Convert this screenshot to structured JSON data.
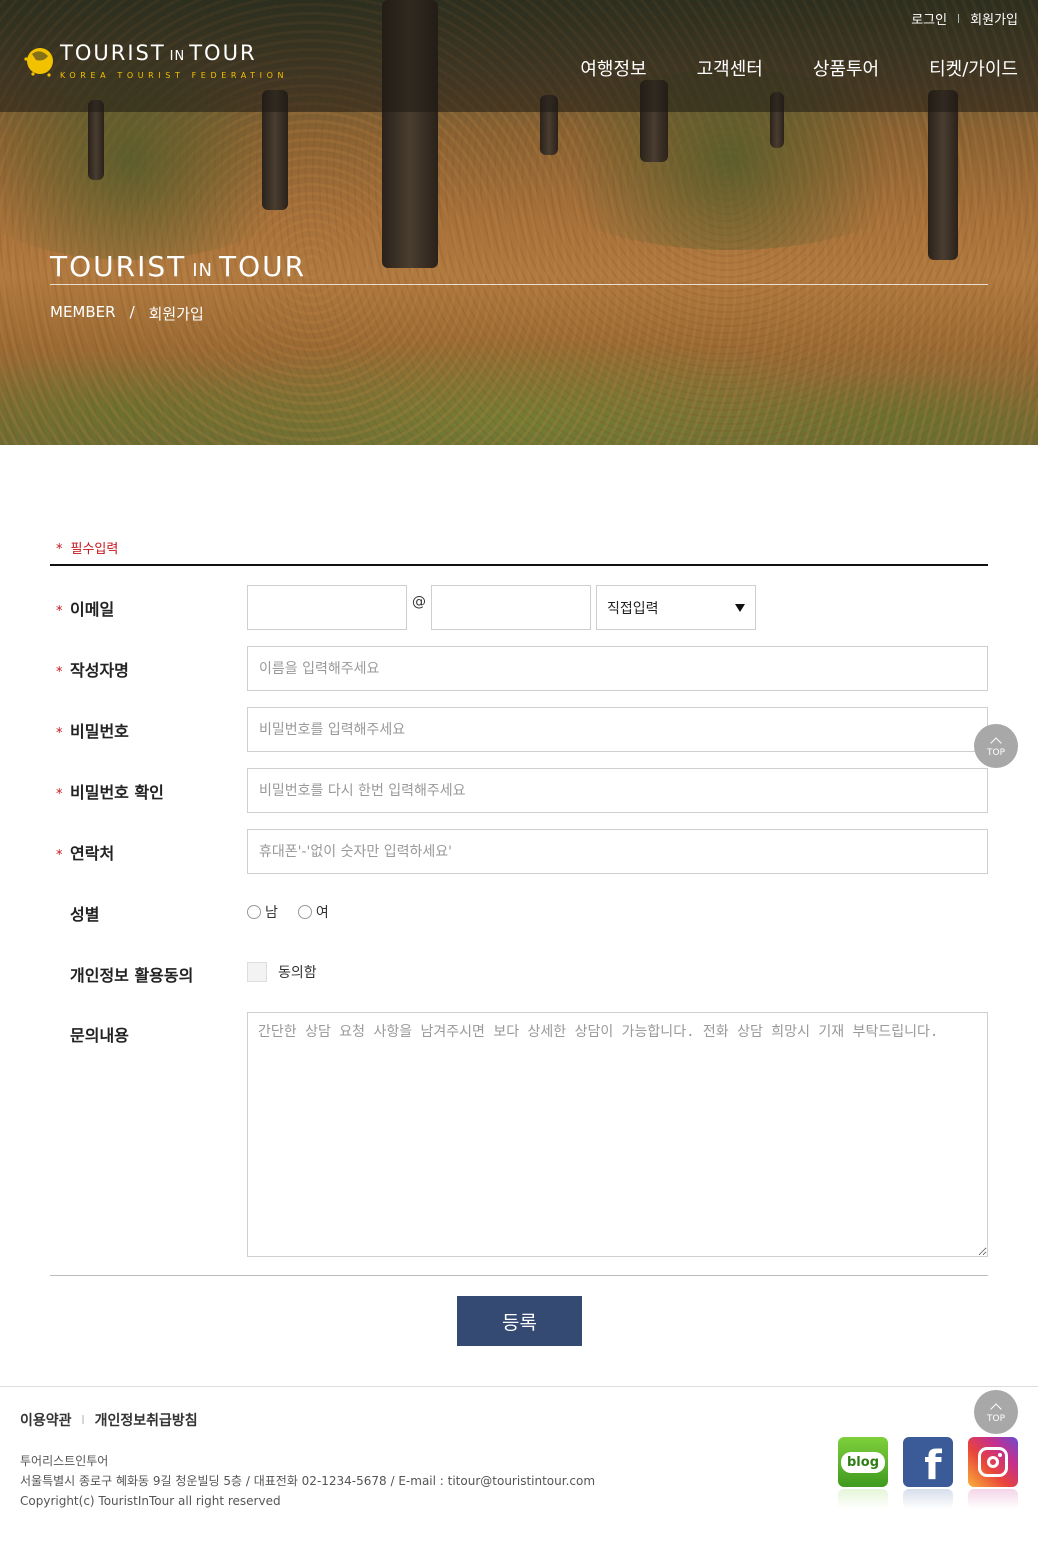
{
  "header": {
    "util_links": [
      "로그인",
      "회원가입"
    ],
    "logo": {
      "title_a": "TOURIST",
      "title_in": "IN",
      "title_b": "TOUR",
      "subtitle": "KOREA TOURIST FEDERATION"
    },
    "nav": [
      "여행정보",
      "고객센터",
      "상품투어",
      "티켓/가이드"
    ]
  },
  "hero": {
    "title_a": "TOURIST",
    "title_in": "IN",
    "title_b": "TOUR",
    "breadcrumb": [
      "MEMBER",
      "/",
      "회원가입"
    ]
  },
  "form": {
    "required_note": "필수입력",
    "required_mark": "*",
    "email": {
      "label": "이메일",
      "at": "@",
      "domain_select": "직접입력"
    },
    "name": {
      "label": "작성자명",
      "placeholder": "이름을 입력해주세요"
    },
    "password": {
      "label": "비밀번호",
      "placeholder": "비밀번호를 입력해주세요"
    },
    "password_confirm": {
      "label": "비밀번호 확인",
      "placeholder": "비밀번호를 다시 한번 입력해주세요"
    },
    "phone": {
      "label": "연락처",
      "placeholder": "휴대폰'-'없이 숫자만 입력하세요'"
    },
    "gender": {
      "label": "성별",
      "options": [
        "남",
        "여"
      ]
    },
    "privacy": {
      "label": "개인정보 활용동의",
      "checkbox_label": "동의함"
    },
    "inquiry": {
      "label": "문의내용",
      "placeholder": "간단한 상담 요청 사항을 남겨주시면 보다 상세한 상담이 가능합니다. 전화 상담 희망시 기재 부탁드립니다."
    },
    "submit_label": "등록"
  },
  "top_button": "TOP",
  "footer": {
    "links": [
      "이용약관",
      "개인정보취급방침"
    ],
    "company": "투어리스트인투어",
    "address": "서울특별시 종로구 혜화동 9길 청운빌딩 5층 / 대표전화 02-1234-5678 / E-mail : titour@touristintour.com",
    "copyright": "Copyright(c) TouristInTour all right reserved",
    "sns": {
      "blog": "blog"
    }
  },
  "colors": {
    "accent_red": "#c4141b",
    "submit_bg": "#344a72",
    "logo_yellow": "#f2c200"
  }
}
